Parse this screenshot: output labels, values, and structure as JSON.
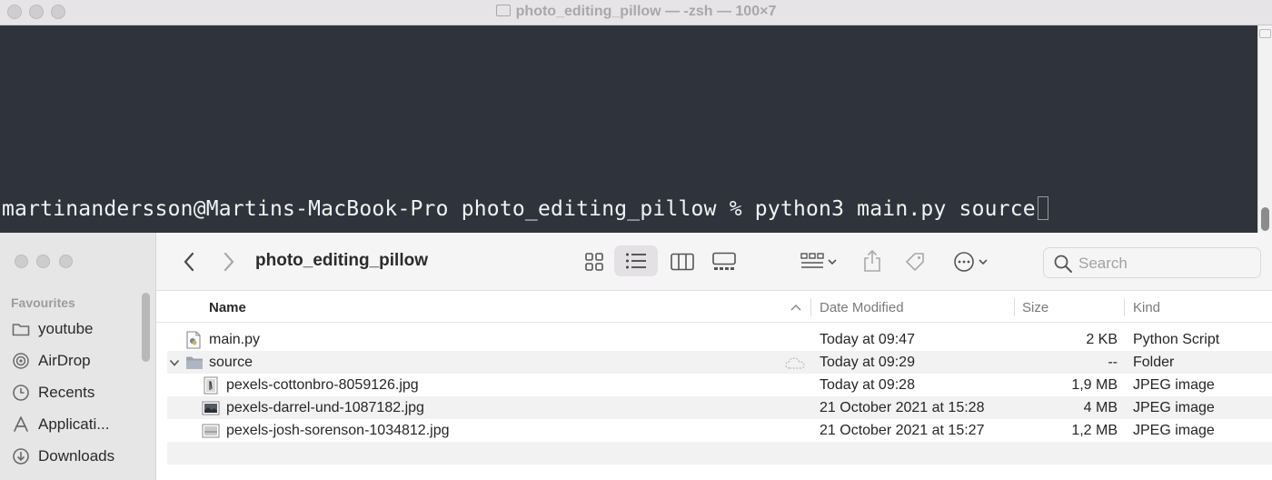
{
  "terminal": {
    "title": "photo_editing_pillow — -zsh — 100×7",
    "prompt": "martinandersson@Martins-MacBook-Pro photo_editing_pillow % ",
    "command": "python3 main.py source"
  },
  "finder": {
    "folder_title": "photo_editing_pillow",
    "search_placeholder": "Search",
    "sidebar": {
      "heading": "Favourites",
      "items": [
        {
          "label": "youtube",
          "icon": "folder-icon"
        },
        {
          "label": "AirDrop",
          "icon": "airdrop-icon"
        },
        {
          "label": "Recents",
          "icon": "clock-icon"
        },
        {
          "label": "Applicati...",
          "icon": "applications-icon"
        },
        {
          "label": "Downloads",
          "icon": "download-icon"
        }
      ]
    },
    "columns": {
      "name": "Name",
      "date": "Date Modified",
      "size": "Size",
      "kind": "Kind"
    },
    "files": [
      {
        "name": "main.py",
        "date": "Today at 09:47",
        "size": "2 KB",
        "kind": "Python Script"
      },
      {
        "name": "source",
        "date": "Today at 09:29",
        "size": "--",
        "kind": "Folder"
      },
      {
        "name": "pexels-cottonbro-8059126.jpg",
        "date": "Today at 09:28",
        "size": "1,9 MB",
        "kind": "JPEG image"
      },
      {
        "name": "pexels-darrel-und-1087182.jpg",
        "date": "21 October 2021 at 15:28",
        "size": "4 MB",
        "kind": "JPEG image"
      },
      {
        "name": "pexels-josh-sorenson-1034812.jpg",
        "date": "21 October 2021 at 15:27",
        "size": "1,2 MB",
        "kind": "JPEG image"
      }
    ]
  }
}
